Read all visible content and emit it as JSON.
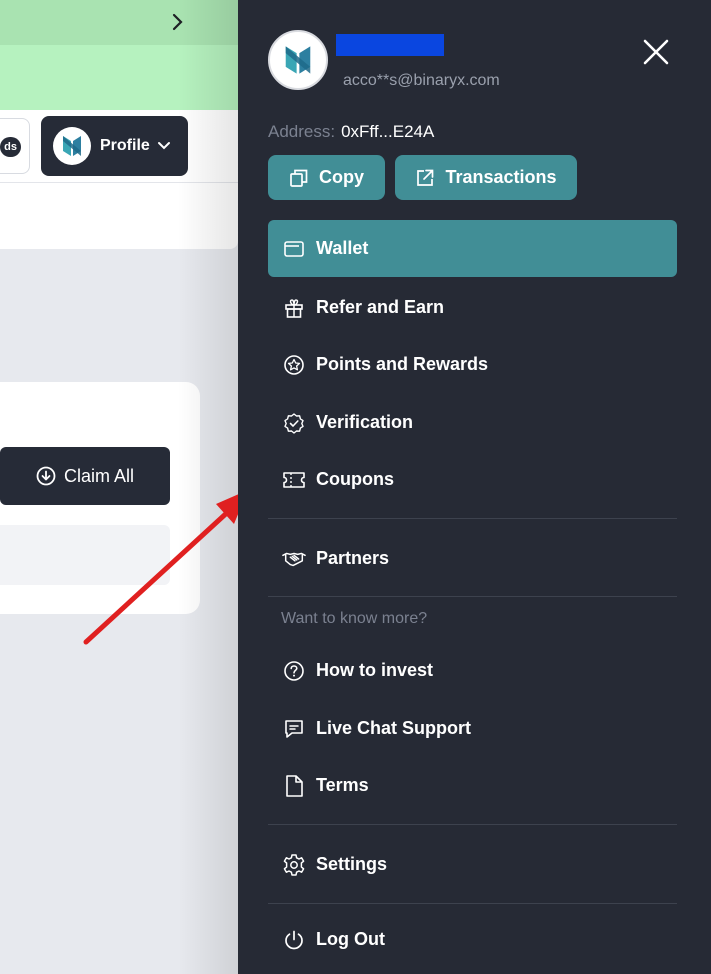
{
  "background": {
    "profile_label": "Profile",
    "pill_text": "ds",
    "claim_label": "Claim All"
  },
  "drawer": {
    "email": "acco**s@binaryx.com",
    "address_label": "Address:",
    "address_value": "0xFff...E24A",
    "copy_label": "Copy",
    "transactions_label": "Transactions",
    "menu": [
      {
        "label": "Wallet",
        "icon": "wallet-icon",
        "active": true
      },
      {
        "label": "Refer and Earn",
        "icon": "gift-icon"
      },
      {
        "label": "Points and Rewards",
        "icon": "star-circle-icon"
      },
      {
        "label": "Verification",
        "icon": "verified-badge-icon"
      },
      {
        "label": "Coupons",
        "icon": "ticket-icon"
      },
      {
        "label": "Partners",
        "icon": "handshake-icon"
      }
    ],
    "section_label": "Want to know more?",
    "info_menu": [
      {
        "label": "How to invest",
        "icon": "help-circle-icon"
      },
      {
        "label": "Live Chat Support",
        "icon": "chat-icon"
      },
      {
        "label": "Terms",
        "icon": "document-icon"
      }
    ],
    "settings_label": "Settings",
    "logout_label": "Log Out"
  },
  "colors": {
    "drawer_bg": "#262a35",
    "accent": "#418e96",
    "annotation_arrow": "#e02020",
    "redaction": "#0a46e0"
  }
}
